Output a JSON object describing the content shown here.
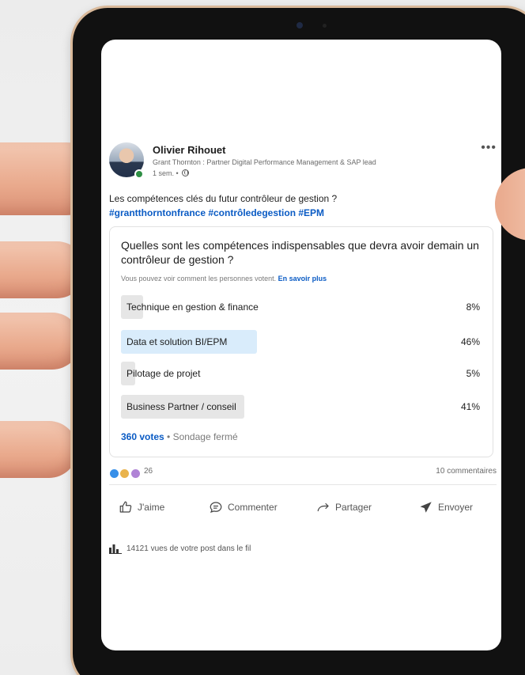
{
  "post": {
    "author_name": "Olivier Rihouet",
    "author_title": "Grant Thornton : Partner Digital Performance Management & SAP lead",
    "time": "1 sem. •",
    "text": "Les compétences clés du futur contrôleur de gestion ?",
    "hashtags": "#grantthorntonfrance #contrôledegestion #EPM",
    "more_label": "•••"
  },
  "poll": {
    "question": "Quelles sont les compétences indispensables que devra avoir demain un contrôleur de gestion ?",
    "note": "Vous pouvez voir comment les personnes votent.",
    "note_link": "En savoir plus",
    "options": [
      {
        "label": "Technique en gestion & finance",
        "percent_label": "8%",
        "percent": 8,
        "selected": false
      },
      {
        "label": "Data et solution BI/EPM",
        "percent_label": "46%",
        "percent": 46,
        "selected": true
      },
      {
        "label": "Pilotage de projet",
        "percent_label": "5%",
        "percent": 5,
        "selected": false
      },
      {
        "label": "Business Partner / conseil",
        "percent_label": "41%",
        "percent": 41,
        "selected": false
      }
    ],
    "votes": "360 votes",
    "status": " • Sondage fermé"
  },
  "social": {
    "reaction_count": "26",
    "comments": "10 commentaires"
  },
  "actions": {
    "like": "J'aime",
    "comment": "Commenter",
    "share": "Partager",
    "send": "Envoyer"
  },
  "views": "14121 vues de votre post dans le fil",
  "colors": {
    "link": "#0a5bc4",
    "selected_bar": "#d9ecfb",
    "bar": "#e6e6e6"
  }
}
